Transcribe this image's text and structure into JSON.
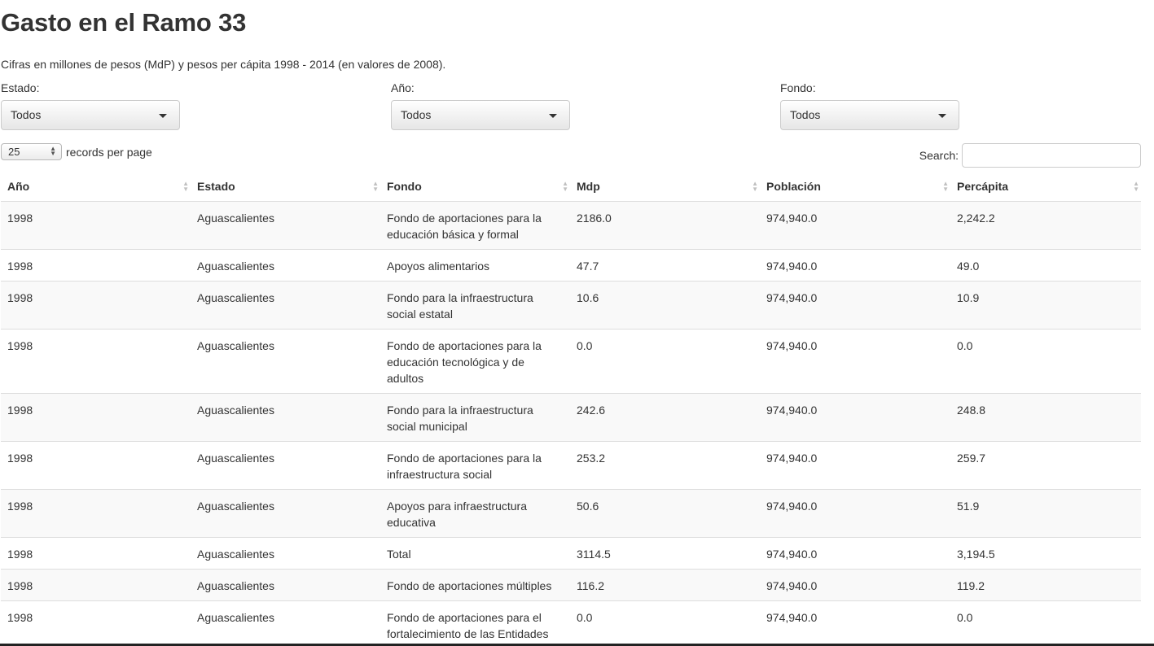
{
  "page": {
    "title": "Gasto en el Ramo 33",
    "subtitle": "Cifras en millones de pesos (MdP) y pesos per cápita 1998 - 2014 (en valores de 2008)."
  },
  "filters": {
    "estado": {
      "label": "Estado:",
      "value": "Todos"
    },
    "anio": {
      "label": "Año:",
      "value": "Todos"
    },
    "fondo": {
      "label": "Fondo:",
      "value": "Todos"
    }
  },
  "table_controls": {
    "length_value": "25",
    "length_label": "records per page",
    "search_label": "Search:",
    "search_value": ""
  },
  "table": {
    "headers": [
      "Año",
      "Estado",
      "Fondo",
      "Mdp",
      "Población",
      "Percápita"
    ],
    "rows": [
      [
        "1998",
        "Aguascalientes",
        "Fondo de aportaciones para la educación básica y formal",
        "2186.0",
        "974,940.0",
        "2,242.2"
      ],
      [
        "1998",
        "Aguascalientes",
        "Apoyos alimentarios",
        "47.7",
        "974,940.0",
        "49.0"
      ],
      [
        "1998",
        "Aguascalientes",
        "Fondo para la infraestructura social estatal",
        "10.6",
        "974,940.0",
        "10.9"
      ],
      [
        "1998",
        "Aguascalientes",
        "Fondo de aportaciones para la educación tecnológica y de adultos",
        "0.0",
        "974,940.0",
        "0.0"
      ],
      [
        "1998",
        "Aguascalientes",
        "Fondo para la infraestructura social municipal",
        "242.6",
        "974,940.0",
        "248.8"
      ],
      [
        "1998",
        "Aguascalientes",
        "Fondo de aportaciones para la infraestructura social",
        "253.2",
        "974,940.0",
        "259.7"
      ],
      [
        "1998",
        "Aguascalientes",
        "Apoyos para infraestructura educativa",
        "50.6",
        "974,940.0",
        "51.9"
      ],
      [
        "1998",
        "Aguascalientes",
        "Total",
        "3114.5",
        "974,940.0",
        "3,194.5"
      ],
      [
        "1998",
        "Aguascalientes",
        "Fondo de aportaciones múltiples",
        "116.2",
        "974,940.0",
        "119.2"
      ],
      [
        "1998",
        "Aguascalientes",
        "Fondo de aportaciones para el fortalecimiento de las Entidades Federativas",
        "0.0",
        "974,940.0",
        "0.0"
      ]
    ]
  }
}
